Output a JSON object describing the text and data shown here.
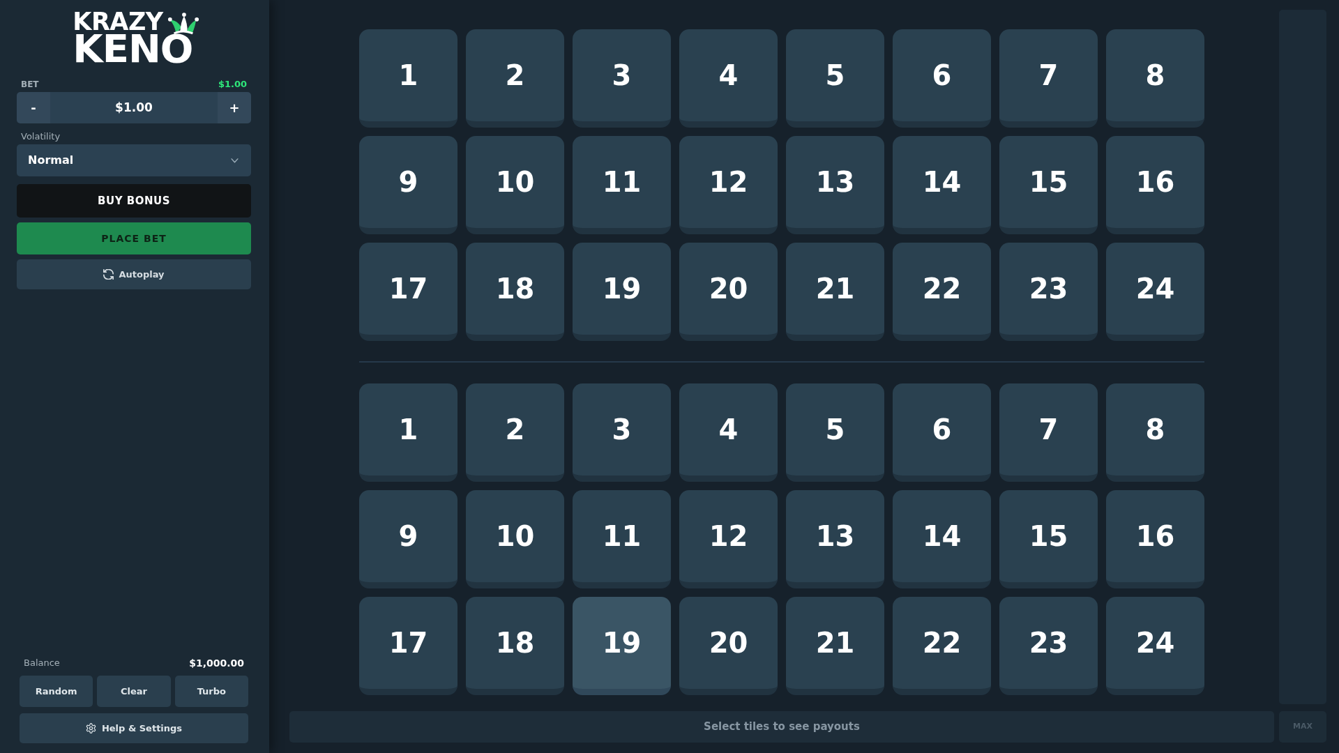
{
  "logo": {
    "lines": [
      "KRAZY",
      "KENO"
    ]
  },
  "bet": {
    "label": "BET",
    "total": "$1.00",
    "decrement": "-",
    "value": "$1.00",
    "increment": "+"
  },
  "volatility": {
    "label": "Volatility",
    "value": "Normal"
  },
  "buttons": [
    {
      "kind": "bonus",
      "label": "BUY BONUS"
    },
    {
      "kind": "bet",
      "label": "PLACE BET"
    },
    {
      "kind": "auto",
      "label": "Autoplay"
    }
  ],
  "balance": {
    "label": "Balance",
    "value": "$1,000.00"
  },
  "actions": [
    "Random",
    "Clear",
    "Turbo"
  ],
  "help": {
    "label": "Help & Settings"
  },
  "boards": [
    {
      "tiles": [
        {
          "label": "1",
          "hovered": false
        },
        {
          "label": "2",
          "hovered": false
        },
        {
          "label": "3",
          "hovered": false
        },
        {
          "label": "4",
          "hovered": false
        },
        {
          "label": "5",
          "hovered": false
        },
        {
          "label": "6",
          "hovered": false
        },
        {
          "label": "7",
          "hovered": false
        },
        {
          "label": "8",
          "hovered": false
        },
        {
          "label": "9",
          "hovered": false
        },
        {
          "label": "10",
          "hovered": false
        },
        {
          "label": "11",
          "hovered": false
        },
        {
          "label": "12",
          "hovered": false
        },
        {
          "label": "13",
          "hovered": false
        },
        {
          "label": "14",
          "hovered": false
        },
        {
          "label": "15",
          "hovered": false
        },
        {
          "label": "16",
          "hovered": false
        },
        {
          "label": "17",
          "hovered": false
        },
        {
          "label": "18",
          "hovered": false
        },
        {
          "label": "19",
          "hovered": false
        },
        {
          "label": "20",
          "hovered": false
        },
        {
          "label": "21",
          "hovered": false
        },
        {
          "label": "22",
          "hovered": false
        },
        {
          "label": "23",
          "hovered": false
        },
        {
          "label": "24",
          "hovered": false
        }
      ]
    },
    {
      "tiles": [
        {
          "label": "1",
          "hovered": false
        },
        {
          "label": "2",
          "hovered": false
        },
        {
          "label": "3",
          "hovered": false
        },
        {
          "label": "4",
          "hovered": false
        },
        {
          "label": "5",
          "hovered": false
        },
        {
          "label": "6",
          "hovered": false
        },
        {
          "label": "7",
          "hovered": false
        },
        {
          "label": "8",
          "hovered": false
        },
        {
          "label": "9",
          "hovered": false
        },
        {
          "label": "10",
          "hovered": false
        },
        {
          "label": "11",
          "hovered": false
        },
        {
          "label": "12",
          "hovered": false
        },
        {
          "label": "13",
          "hovered": false
        },
        {
          "label": "14",
          "hovered": false
        },
        {
          "label": "15",
          "hovered": false
        },
        {
          "label": "16",
          "hovered": false
        },
        {
          "label": "17",
          "hovered": false
        },
        {
          "label": "18",
          "hovered": false
        },
        {
          "label": "19",
          "hovered": true
        },
        {
          "label": "20",
          "hovered": false
        },
        {
          "label": "21",
          "hovered": false
        },
        {
          "label": "22",
          "hovered": false
        },
        {
          "label": "23",
          "hovered": false
        },
        {
          "label": "24",
          "hovered": false
        }
      ]
    }
  ],
  "payout_bar": {
    "message": "Select tiles to see payouts"
  },
  "max_button": {
    "label": "MAX",
    "disabled": true
  }
}
